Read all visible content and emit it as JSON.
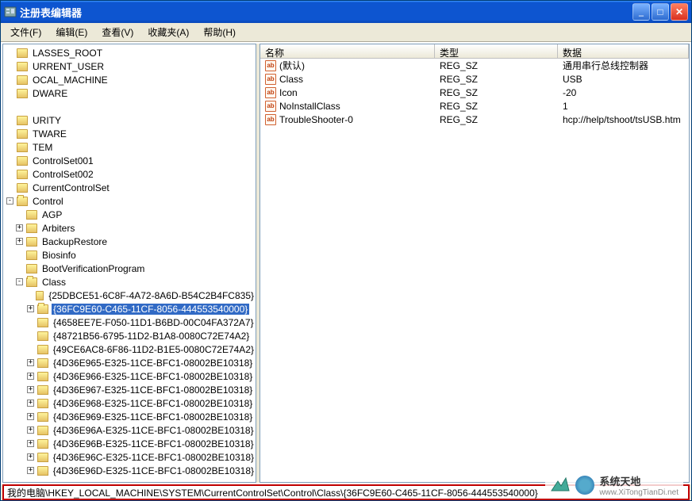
{
  "window": {
    "title": "注册表编辑器"
  },
  "menu": {
    "file": "文件(F)",
    "edit": "编辑(E)",
    "view": "查看(V)",
    "favorites": "收藏夹(A)",
    "help": "帮助(H)"
  },
  "columns": {
    "name": "名称",
    "type": "类型",
    "data": "数据"
  },
  "values": [
    {
      "name": "(默认)",
      "type": "REG_SZ",
      "data": "通用串行总线控制器"
    },
    {
      "name": "Class",
      "type": "REG_SZ",
      "data": "USB"
    },
    {
      "name": "Icon",
      "type": "REG_SZ",
      "data": "-20"
    },
    {
      "name": "NoInstallClass",
      "type": "REG_SZ",
      "data": "1"
    },
    {
      "name": "TroubleShooter-0",
      "type": "REG_SZ",
      "data": "hcp://help/tshoot/tsUSB.htm"
    }
  ],
  "tree": {
    "roots": [
      "LASSES_ROOT",
      "URRENT_USER",
      "OCAL_MACHINE",
      "DWARE",
      "",
      "URITY",
      "TWARE",
      "TEM",
      "ControlSet001",
      "ControlSet002",
      "CurrentControlSet"
    ],
    "control": "Control",
    "control_children": [
      {
        "label": "AGP",
        "expander": ""
      },
      {
        "label": "Arbiters",
        "expander": "+"
      },
      {
        "label": "BackupRestore",
        "expander": "+"
      },
      {
        "label": "Biosinfo",
        "expander": ""
      },
      {
        "label": "BootVerificationProgram",
        "expander": ""
      }
    ],
    "class_label": "Class",
    "class_children": [
      {
        "label": "{25DBCE51-6C8F-4A72-8A6D-B54C2B4FC835}",
        "expander": ""
      },
      {
        "label": "{36FC9E60-C465-11CF-8056-444553540000}",
        "expander": "+",
        "selected": true
      },
      {
        "label": "{4658EE7E-F050-11D1-B6BD-00C04FA372A7}",
        "expander": ""
      },
      {
        "label": "{48721B56-6795-11D2-B1A8-0080C72E74A2}",
        "expander": ""
      },
      {
        "label": "{49CE6AC8-6F86-11D2-B1E5-0080C72E74A2}",
        "expander": ""
      },
      {
        "label": "{4D36E965-E325-11CE-BFC1-08002BE10318}",
        "expander": "+"
      },
      {
        "label": "{4D36E966-E325-11CE-BFC1-08002BE10318}",
        "expander": "+"
      },
      {
        "label": "{4D36E967-E325-11CE-BFC1-08002BE10318}",
        "expander": "+"
      },
      {
        "label": "{4D36E968-E325-11CE-BFC1-08002BE10318}",
        "expander": "+"
      },
      {
        "label": "{4D36E969-E325-11CE-BFC1-08002BE10318}",
        "expander": "+"
      },
      {
        "label": "{4D36E96A-E325-11CE-BFC1-08002BE10318}",
        "expander": "+"
      },
      {
        "label": "{4D36E96B-E325-11CE-BFC1-08002BE10318}",
        "expander": "+"
      },
      {
        "label": "{4D36E96C-E325-11CE-BFC1-08002BE10318}",
        "expander": "+"
      },
      {
        "label": "{4D36E96D-E325-11CE-BFC1-08002BE10318}",
        "expander": "+"
      }
    ]
  },
  "statusbar": "我的电脑\\HKEY_LOCAL_MACHINE\\SYSTEM\\CurrentControlSet\\Control\\Class\\{36FC9E60-C465-11CF-8056-444553540000}",
  "watermark": {
    "brand": "系统天地",
    "url": "www.XiTongTianDi.net"
  }
}
